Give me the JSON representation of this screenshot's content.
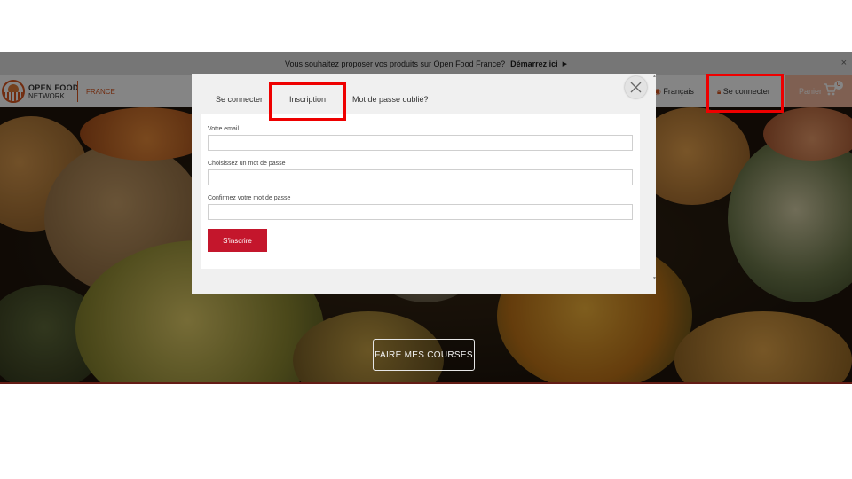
{
  "banner": {
    "text": "Vous souhaitez proposer vos produits sur Open Food France?",
    "cta": "Démarrez ici",
    "close": "×"
  },
  "navbar": {
    "brand_line1": "OPEN FOOD",
    "brand_line2": "NETWORK",
    "country": "FRANCE",
    "language": "Français",
    "login": "Se connecter",
    "cart_label": "Panier",
    "cart_count": "0"
  },
  "hero": {
    "button": "FAIRE MES COURSES"
  },
  "modal": {
    "tabs": [
      {
        "label": "Se connecter",
        "active": false
      },
      {
        "label": "Inscription",
        "active": true
      },
      {
        "label": "Mot de passe oublié?",
        "active": false
      }
    ],
    "fields": [
      {
        "label": "Votre email",
        "value": ""
      },
      {
        "label": "Choisissez un mot de passe",
        "value": ""
      },
      {
        "label": "Confirmez votre mot de passe",
        "value": ""
      }
    ],
    "submit": "S'inscrire"
  },
  "colors": {
    "brand_orange": "#d8551e",
    "submit_red": "#c4162c",
    "highlight": "#ee0000"
  },
  "icons": [
    "logo-icon",
    "lock-icon",
    "cart-icon",
    "close-icon",
    "globe-icon"
  ]
}
